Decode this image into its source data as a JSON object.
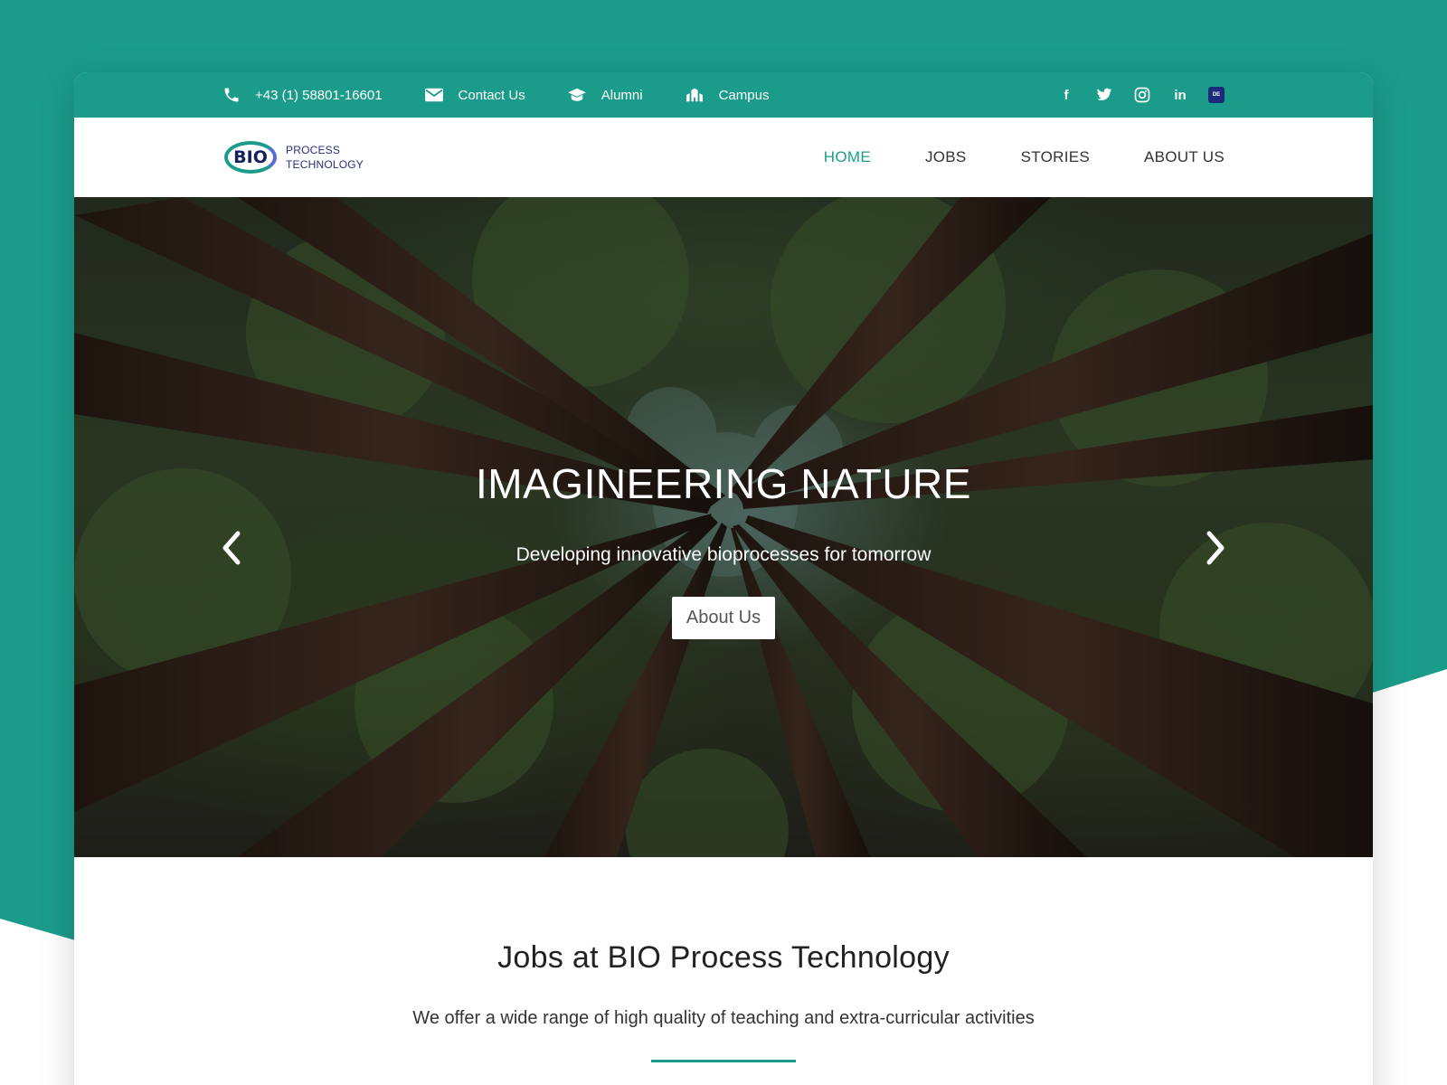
{
  "topbar": {
    "phone": "+43 (1) 58801-16601",
    "contact": "Contact Us",
    "alumni": "Alumni",
    "campus": "Campus",
    "social_facebook": "f",
    "social_linkedin": "in",
    "language_badge": "DE"
  },
  "logo": {
    "mark": "BIO",
    "line1": "PROCESS",
    "line2": "TECHNOLOGY"
  },
  "nav": {
    "items": [
      {
        "label": "HOME",
        "active": true
      },
      {
        "label": "JOBS"
      },
      {
        "label": "STORIES"
      },
      {
        "label": "ABOUT US"
      }
    ]
  },
  "hero": {
    "title": "IMAGINEERING NATURE",
    "subtitle": "Developing innovative bioprocesses for tomorrow",
    "button": "About Us"
  },
  "jobs": {
    "title": "Jobs at BIO Process Technology",
    "description": "We offer a wide range of high quality of teaching and extra-curricular activities"
  },
  "colors": {
    "brand": "#1b9c8b",
    "logo_navy": "#14215e"
  },
  "icons": [
    "phone-icon",
    "mail-icon",
    "graduation-cap-icon",
    "campus-building-icon",
    "facebook-icon",
    "twitter-icon",
    "instagram-icon",
    "linkedin-icon",
    "chevron-left-icon",
    "chevron-right-icon"
  ]
}
